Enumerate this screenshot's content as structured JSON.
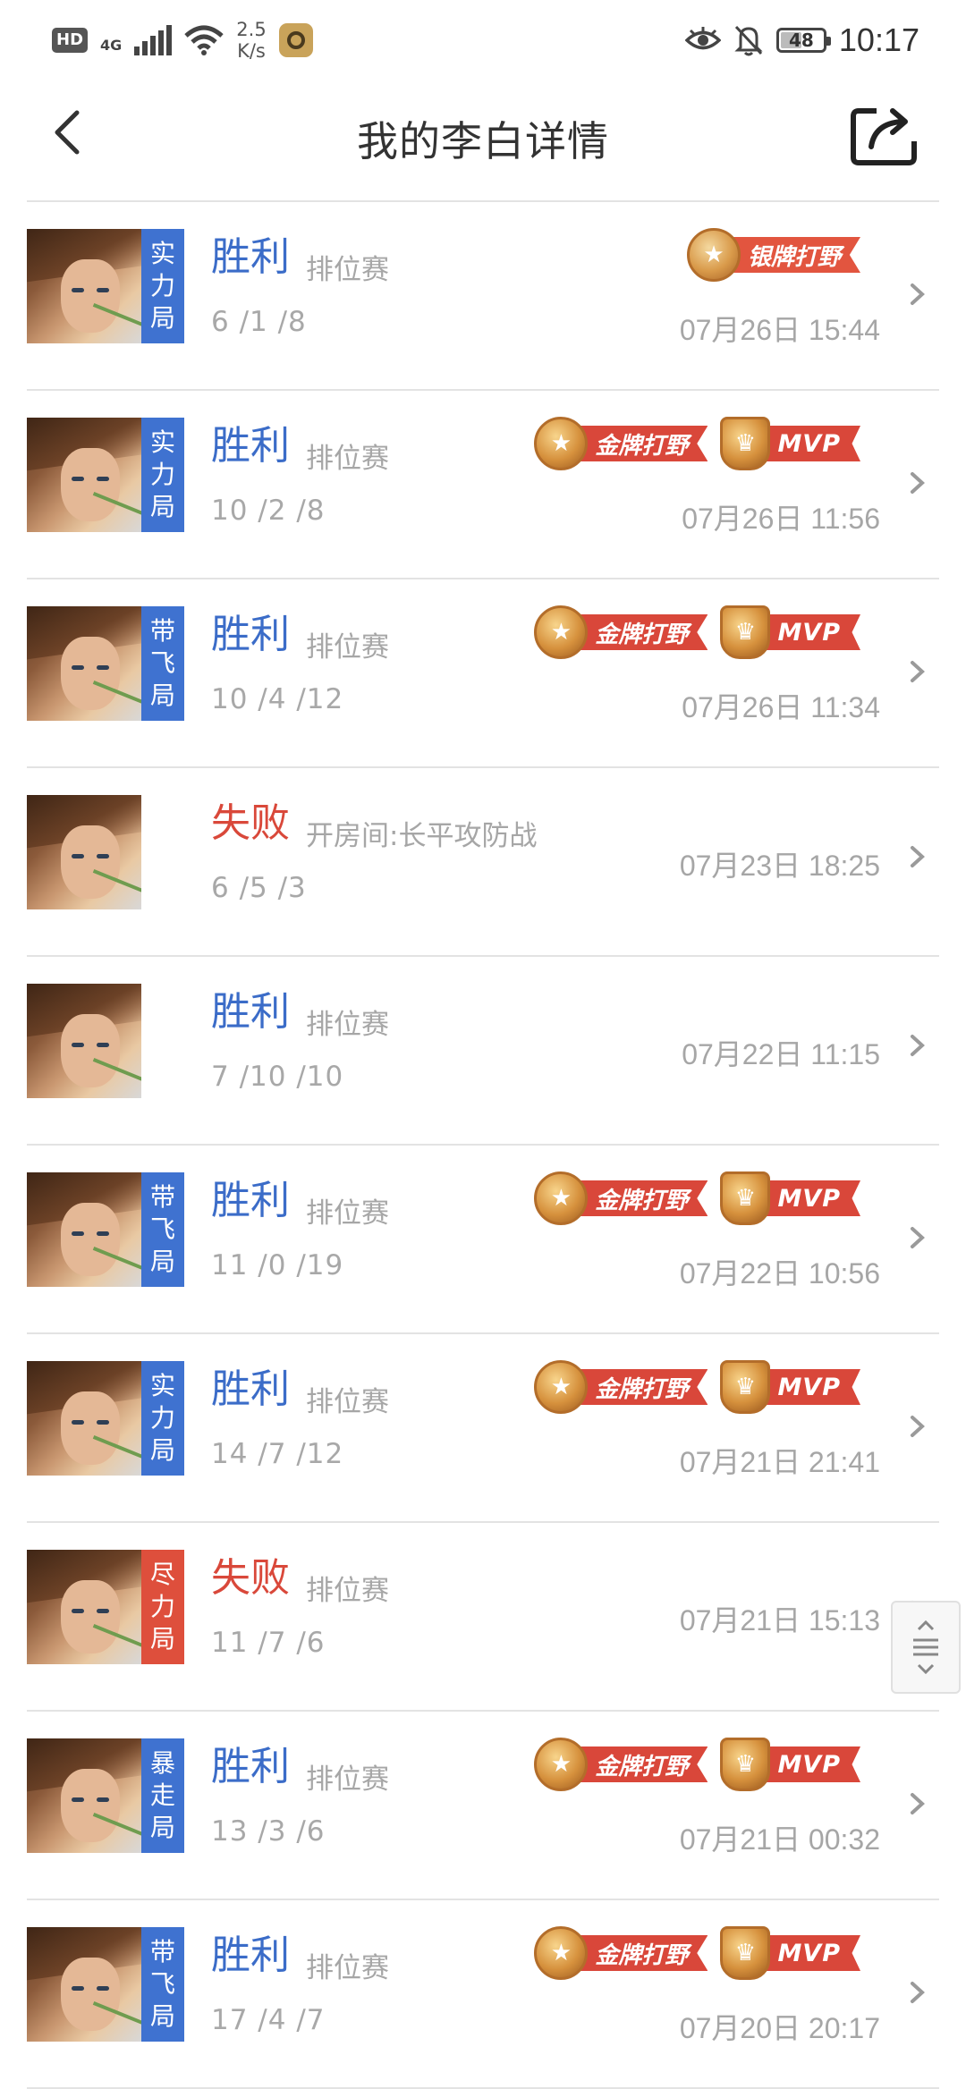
{
  "status_bar": {
    "hd_label": "HD",
    "network_label": "4G",
    "speed_value": "2.5",
    "speed_unit": "K/s",
    "battery_level": "48",
    "time": "10:17"
  },
  "header": {
    "title": "我的李白详情"
  },
  "matches": [
    {
      "tag": [
        "实",
        "力",
        "局"
      ],
      "tag_color": "blue",
      "result": "胜利",
      "result_type": "win",
      "mode": "排位赛",
      "kda": "6 /1 /8",
      "datetime": "07月26日 15:44",
      "medals": [
        {
          "type": "silver",
          "label": "银牌打野"
        }
      ]
    },
    {
      "tag": [
        "实",
        "力",
        "局"
      ],
      "tag_color": "blue",
      "result": "胜利",
      "result_type": "win",
      "mode": "排位赛",
      "kda": "10 /2 /8",
      "datetime": "07月26日 11:56",
      "medals": [
        {
          "type": "gold",
          "label": "金牌打野"
        },
        {
          "type": "mvp",
          "label": "MVP"
        }
      ]
    },
    {
      "tag": [
        "带",
        "飞",
        "局"
      ],
      "tag_color": "blue",
      "result": "胜利",
      "result_type": "win",
      "mode": "排位赛",
      "kda": "10 /4 /12",
      "datetime": "07月26日 11:34",
      "medals": [
        {
          "type": "gold",
          "label": "金牌打野"
        },
        {
          "type": "mvp",
          "label": "MVP"
        }
      ]
    },
    {
      "tag": [],
      "tag_color": "",
      "result": "失败",
      "result_type": "lose",
      "mode": "开房间:长平攻防战",
      "kda": "6 /5 /3",
      "datetime": "07月23日 18:25",
      "medals": []
    },
    {
      "tag": [],
      "tag_color": "",
      "result": "胜利",
      "result_type": "win",
      "mode": "排位赛",
      "kda": "7 /10 /10",
      "datetime": "07月22日 11:15",
      "medals": []
    },
    {
      "tag": [
        "带",
        "飞",
        "局"
      ],
      "tag_color": "blue",
      "result": "胜利",
      "result_type": "win",
      "mode": "排位赛",
      "kda": "11 /0 /19",
      "datetime": "07月22日 10:56",
      "medals": [
        {
          "type": "gold",
          "label": "金牌打野"
        },
        {
          "type": "mvp",
          "label": "MVP"
        }
      ]
    },
    {
      "tag": [
        "实",
        "力",
        "局"
      ],
      "tag_color": "blue",
      "result": "胜利",
      "result_type": "win",
      "mode": "排位赛",
      "kda": "14 /7 /12",
      "datetime": "07月21日 21:41",
      "medals": [
        {
          "type": "gold",
          "label": "金牌打野"
        },
        {
          "type": "mvp",
          "label": "MVP"
        }
      ]
    },
    {
      "tag": [
        "尽",
        "力",
        "局"
      ],
      "tag_color": "red",
      "result": "失败",
      "result_type": "lose",
      "mode": "排位赛",
      "kda": "11 /7 /6",
      "datetime": "07月21日 15:13",
      "medals": []
    },
    {
      "tag": [
        "暴",
        "走",
        "局"
      ],
      "tag_color": "blue",
      "result": "胜利",
      "result_type": "win",
      "mode": "排位赛",
      "kda": "13 /3 /6",
      "datetime": "07月21日 00:32",
      "medals": [
        {
          "type": "gold",
          "label": "金牌打野"
        },
        {
          "type": "mvp",
          "label": "MVP"
        }
      ]
    },
    {
      "tag": [
        "带",
        "飞",
        "局"
      ],
      "tag_color": "blue",
      "result": "胜利",
      "result_type": "win",
      "mode": "排位赛",
      "kda": "17 /4 /7",
      "datetime": "07月20日 20:17",
      "medals": [
        {
          "type": "gold",
          "label": "金牌打野"
        },
        {
          "type": "mvp",
          "label": "MVP"
        }
      ]
    }
  ],
  "colors": {
    "win": "#3b6cc8",
    "lose": "#d9483a",
    "tag_blue": "#3f72d0",
    "tag_red": "#de4f3c",
    "medal_ribbon": "#d9473a"
  },
  "icons": {
    "back": "chevron-left-icon",
    "share": "share-icon",
    "row_arrow": "chevron-right-icon",
    "float": "scroll-handle-icon"
  }
}
